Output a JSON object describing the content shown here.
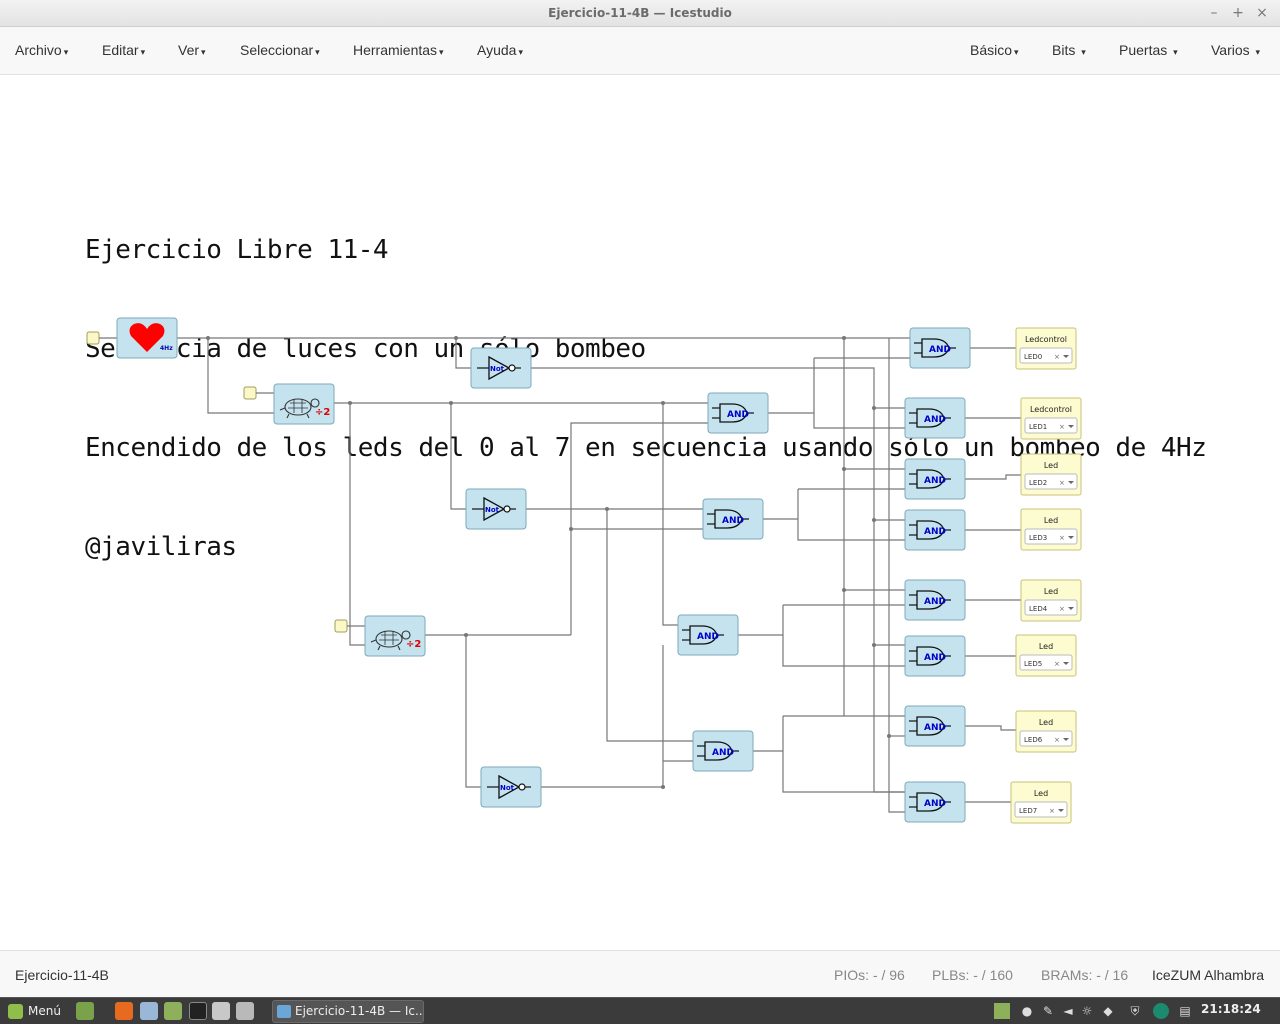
{
  "window": {
    "title": "Ejercicio-11-4B — Icestudio"
  },
  "menu_left": [
    {
      "label": "Archivo"
    },
    {
      "label": "Editar"
    },
    {
      "label": "Ver"
    },
    {
      "label": "Seleccionar"
    },
    {
      "label": "Herramientas"
    },
    {
      "label": "Ayuda"
    }
  ],
  "menu_right": [
    {
      "label": "Básico"
    },
    {
      "label": "Bits"
    },
    {
      "label": "Puertas"
    },
    {
      "label": "Varios"
    }
  ],
  "comment": [
    "Ejercicio Libre 11-4",
    "Secuencia de luces con un sólo bombeo",
    "Encendido de los leds del 0 al 7 en secuencia usando sólo un bombeo de 4Hz",
    "@javiliras"
  ],
  "blocks": {
    "heartbeat_label": "4Hz",
    "divider_label": "÷2",
    "not_label": "Not",
    "and_label": "AND",
    "outputs": [
      {
        "title": "Ledcontrol",
        "pin": "LED0"
      },
      {
        "title": "Ledcontrol",
        "pin": "LED1"
      },
      {
        "title": "Led",
        "pin": "LED2"
      },
      {
        "title": "Led",
        "pin": "LED3"
      },
      {
        "title": "Led",
        "pin": "LED4"
      },
      {
        "title": "Led",
        "pin": "LED5"
      },
      {
        "title": "Led",
        "pin": "LED6"
      },
      {
        "title": "Led",
        "pin": "LED7"
      }
    ],
    "select_clear": "×"
  },
  "status": {
    "project": "Ejercicio-11-4B",
    "pios": "PIOs:  - / 96",
    "plbs": "PLBs:  - / 160",
    "brams": "BRAMs:  - / 16",
    "board": "IceZUM Alhambra"
  },
  "taskbar": {
    "menu_label": "Menú",
    "task_label": "Ejercicio-11-4B — Ic...",
    "clock": "21:18:24"
  },
  "colors": {
    "block_fill": "#c5e3ee",
    "output_fill": "#fdfbd0",
    "wire": "#777777",
    "and_text": "#0000cc",
    "heart": "#ff0000"
  }
}
